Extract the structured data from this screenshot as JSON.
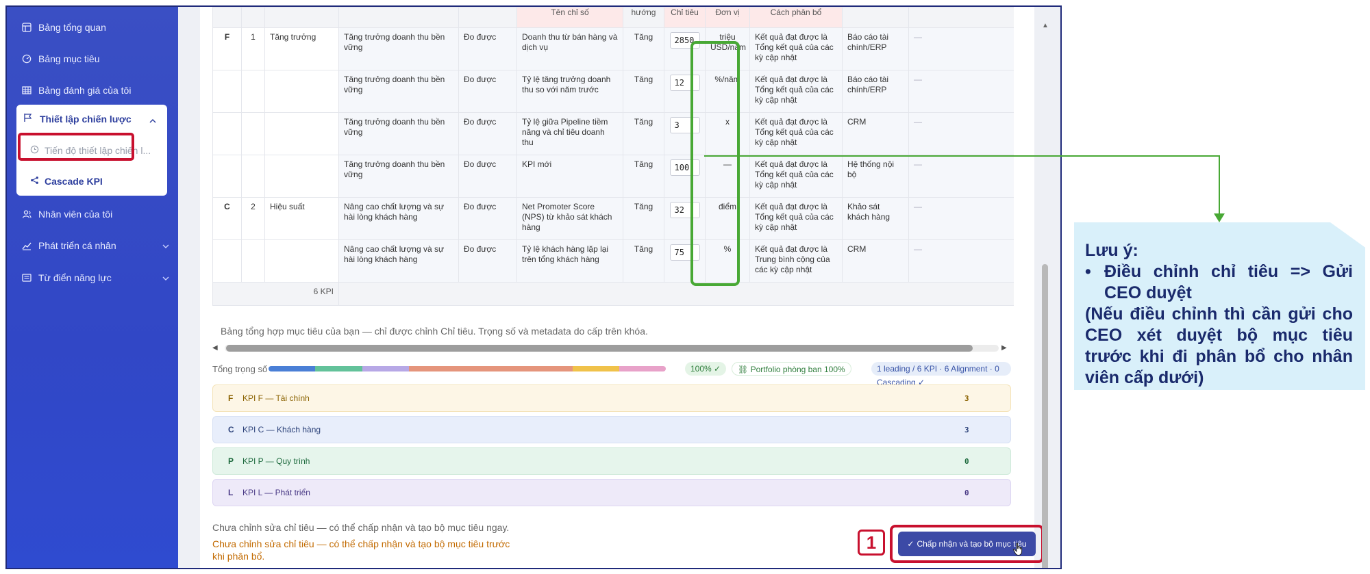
{
  "sidebar": {
    "items": [
      {
        "label": "Bảng tổng quan",
        "icon": "grid-icon"
      },
      {
        "label": "Bảng mục tiêu",
        "icon": "target-icon"
      },
      {
        "label": "Bảng đánh giá của tôi",
        "icon": "table-icon"
      }
    ],
    "strategy": {
      "label": "Thiết lập chiến lược",
      "icon": "flag-icon",
      "subitems": [
        {
          "label": "Tiến độ thiết lập chiến l...",
          "icon": "clock-icon"
        },
        {
          "label": "Cascade KPI",
          "icon": "share-icon"
        }
      ]
    },
    "lower_items": [
      {
        "label": "Nhân viên của tôi",
        "icon": "users-icon"
      },
      {
        "label": "Phát triển cá nhân",
        "icon": "chart-line-icon"
      },
      {
        "label": "Từ điển năng lực",
        "icon": "book-icon"
      }
    ]
  },
  "table": {
    "headers": [
      "",
      "",
      "",
      "",
      "",
      "Tên chỉ số",
      "hướng",
      "Chỉ tiêu",
      "Đơn vị",
      "Cách phân bổ",
      "",
      ""
    ],
    "rows": [
      {
        "code": "F",
        "no": "1",
        "group": "Tăng trưởng",
        "objective": "Tăng trưởng doanh thu bền vững",
        "measure": "Đo được",
        "kpi": "Doanh thu từ bán hàng và dịch vụ",
        "direction": "Tăng",
        "target": "2850",
        "unit": "triệu USD/năm",
        "method": "Kết quả đạt được là Tổng kết quả của các kỳ cập nhật",
        "source": "Báo cáo tài chính/ERP",
        "extra": "—"
      },
      {
        "code": "",
        "no": "",
        "group": "",
        "objective": "Tăng trưởng doanh thu bền vững",
        "measure": "Đo được",
        "kpi": "Tỷ lệ tăng trưởng doanh thu so với năm trước",
        "direction": "Tăng",
        "target": "12",
        "unit": "%/năm",
        "method": "Kết quả đạt được là Tổng kết quả của các kỳ cập nhật",
        "source": "Báo cáo tài chính/ERP",
        "extra": "—"
      },
      {
        "code": "",
        "no": "",
        "group": "",
        "objective": "Tăng trưởng doanh thu bền vững",
        "measure": "Đo được",
        "kpi": "Tỷ lệ giữa Pipeline tiềm năng và chỉ tiêu doanh thu",
        "direction": "Tăng",
        "target": "3",
        "unit": "x",
        "method": "Kết quả đạt được là Tổng kết quả của các kỳ cập nhật",
        "source": "CRM",
        "extra": "—"
      },
      {
        "code": "",
        "no": "",
        "group": "",
        "objective": "Tăng trưởng doanh thu bền vững",
        "measure": "Đo được",
        "kpi": "KPI mới",
        "direction": "Tăng",
        "target": "100",
        "unit": "—",
        "method": "Kết quả đạt được là Tổng kết quả của các kỳ cập nhật",
        "source": "Hệ thống nội bộ",
        "extra": "—"
      },
      {
        "code": "C",
        "no": "2",
        "group": "Hiệu suất",
        "objective": "Nâng cao chất lượng và sự hài lòng khách hàng",
        "measure": "Đo được",
        "kpi": "Net Promoter Score (NPS) từ khảo sát khách hàng",
        "direction": "Tăng",
        "target": "32",
        "unit": "điểm",
        "method": "Kết quả đạt được là Tổng kết quả của các kỳ cập nhật",
        "source": "Khảo sát khách hàng",
        "extra": "—"
      },
      {
        "code": "",
        "no": "",
        "group": "",
        "objective": "Nâng cao chất lượng và sự hài lòng khách hàng",
        "measure": "Đo được",
        "kpi": "Tỷ lệ khách hàng lặp lại trên tổng khách hàng",
        "direction": "Tăng",
        "target": "75",
        "unit": "%",
        "method": "Kết quả đạt được là Trung bình cộng của các kỳ cập nhật",
        "source": "CRM",
        "extra": "—"
      }
    ],
    "summary_label": "6 KPI"
  },
  "note": "Bảng tổng hợp mục tiêu của bạn — chỉ được chỉnh Chỉ tiêu. Trọng số và metadata do cấp trên khóa.",
  "weights": {
    "label": "Tổng trọng số",
    "segments": [
      {
        "color": "#4a7fd6",
        "fraction": 0.118
      },
      {
        "color": "#63c29a",
        "fraction": 0.118
      },
      {
        "color": "#b7a8e6",
        "fraction": 0.118
      },
      {
        "color": "#e5957c",
        "fraction": 0.412
      },
      {
        "color": "#f0c24a",
        "fraction": 0.117
      },
      {
        "color": "#e8a2c9",
        "fraction": 0.117
      }
    ],
    "total_badge": "100% ✓",
    "portfolio_badge": "Portfolio phòng ban 100%",
    "summary_badge": "1 leading / 6 KPI · 6 Alignment · 0 Cascading ✓"
  },
  "groups": [
    {
      "code": "F",
      "name": "KPI F — Tài chính",
      "count": "3"
    },
    {
      "code": "C",
      "name": "KPI C — Khách hàng",
      "count": "3"
    },
    {
      "code": "P",
      "name": "KPI P — Quy trình",
      "count": "0"
    },
    {
      "code": "L",
      "name": "KPI L — Phát triển",
      "count": "0"
    }
  ],
  "footer": {
    "message_gray": "Chưa chỉnh sửa chỉ tiêu — có thể chấp nhận và tạo bộ mục tiêu ngay.",
    "message_orange": "Chưa chỉnh sửa chỉ tiêu — có thể chấp nhận và tạo bộ mục tiêu trước khi phân bổ.",
    "accept_button": "Chấp nhận và tạo bộ mục tiêu",
    "accept_check": "✓"
  },
  "annotation": {
    "step": "1",
    "title": "Lưu ý:",
    "bullet_mark": "•",
    "bullet": "Điều chỉnh chỉ tiêu => Gửi CEO duyệt",
    "detail": "(Nếu điều chỉnh thì cần gửi cho CEO xét duyệt bộ mục tiêu trước khi đi phân bổ cho nhân viên cấp dưới)"
  },
  "colors": {
    "sidebar": "#3147c6",
    "highlight_red": "#c8102e",
    "highlight_green": "#48a835",
    "callout_bg": "#d9f0fa",
    "callout_text": "#1a2a6c",
    "button": "#3c4aa6"
  }
}
